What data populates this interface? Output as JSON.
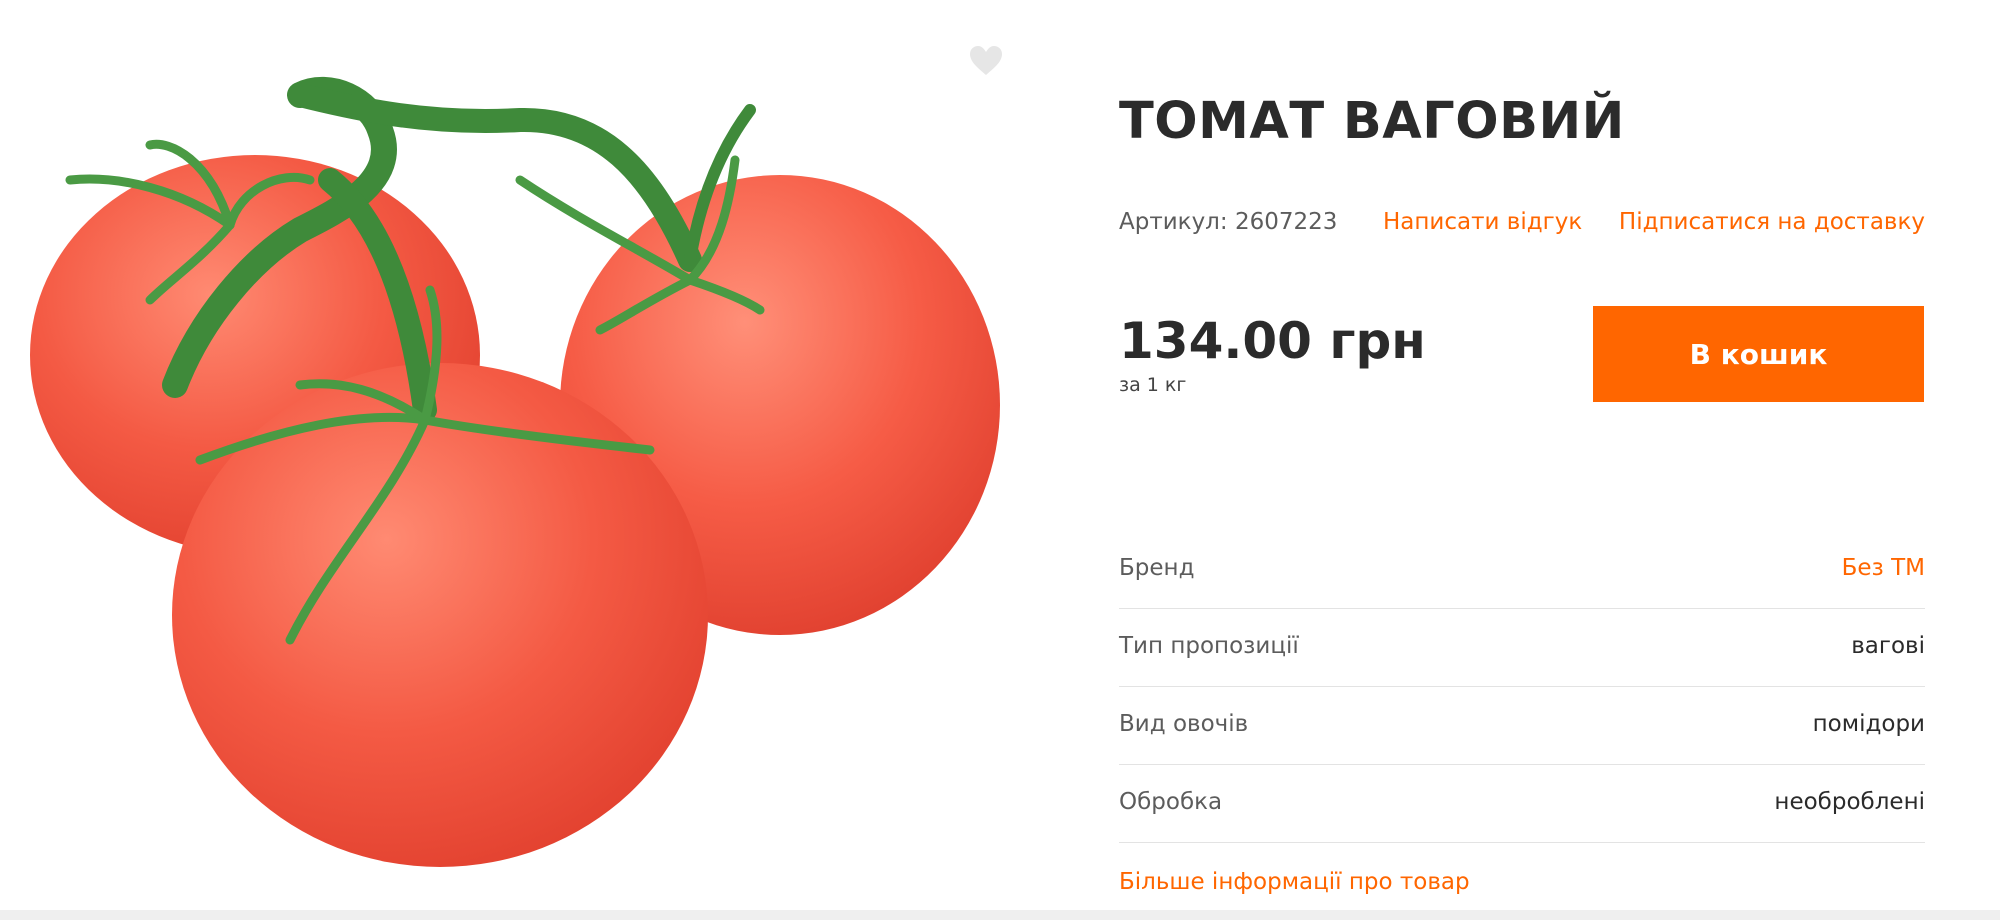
{
  "product": {
    "title": "ТОМАТ ВАГОВИЙ",
    "sku": "Артикул: 2607223",
    "review_link": "Написати відгук",
    "subscribe_link": "Підписатися на доставку",
    "price": "134.00 грн",
    "per_unit": "за 1 кг",
    "cart_button": "В кошик",
    "more_info_link": "Більше інформації про товар"
  },
  "attributes": [
    {
      "label": "Бренд",
      "value": "Без ТМ"
    },
    {
      "label": "Тип пропозиції",
      "value": "вагові"
    },
    {
      "label": "Вид овочів",
      "value": "помідори"
    },
    {
      "label": "Обробка",
      "value": "необроблені"
    }
  ],
  "icons": {
    "favorite": "heart-icon"
  },
  "colors": {
    "accent": "#ff6600",
    "text": "#2b2b2b",
    "muted": "#5c5c5c",
    "divider": "#e3e3e3",
    "tomato": "#f25a45"
  }
}
